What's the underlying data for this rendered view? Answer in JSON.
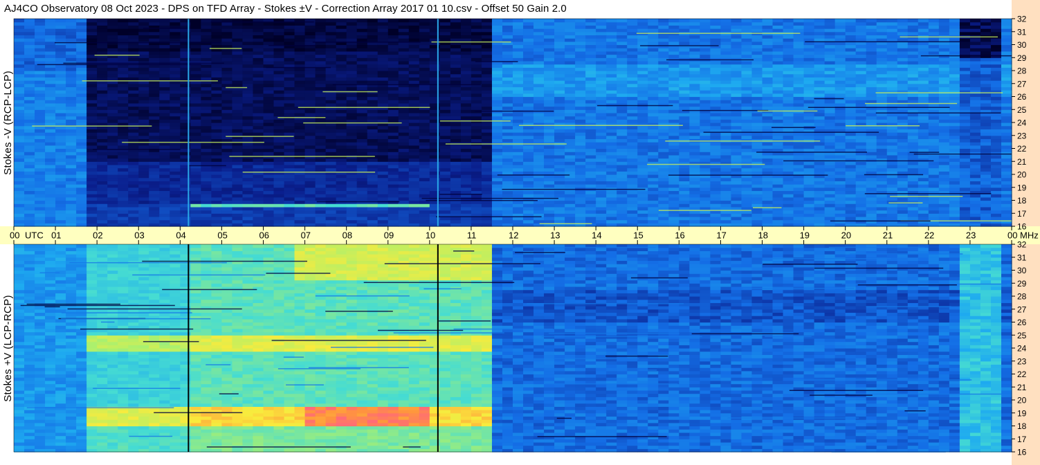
{
  "title": "AJ4CO Observatory  08 Oct 2023  -  DPS on TFD Array  -  Stokes ±V  -  Correction Array 2017 01 10.csv  -  Offset 50  Gain 2.0",
  "colors": {
    "axis_band": "#ffffc0",
    "right_band": "#ffe0c0",
    "tick": "#000000",
    "marker_top": "#2aa8e8",
    "marker_bottom": "#000000"
  },
  "chart_data": [
    {
      "type": "heatmap",
      "panel": "top",
      "ylabel": "Stokes -V (RCP-LCP)",
      "x_unit": "UTC",
      "y_unit": "MHz",
      "xlim": [
        0,
        24
      ],
      "ylim": [
        16,
        32
      ],
      "x_ticks": [
        "00",
        "01",
        "02",
        "03",
        "04",
        "05",
        "06",
        "07",
        "08",
        "09",
        "10",
        "11",
        "12",
        "13",
        "14",
        "15",
        "16",
        "17",
        "18",
        "19",
        "20",
        "21",
        "22",
        "23",
        "00"
      ],
      "y_ticks": [
        "16",
        "17",
        "18",
        "19",
        "20",
        "21",
        "22",
        "23",
        "24",
        "25",
        "26",
        "27",
        "28",
        "29",
        "30",
        "31",
        "32"
      ],
      "colormap": "jet",
      "vertical_markers_utc": [
        4.2,
        10.2
      ]
    },
    {
      "type": "heatmap",
      "panel": "bottom",
      "ylabel": "Stokes +V (LCP-RCP)",
      "x_unit": "UTC",
      "y_unit": "MHz",
      "xlim": [
        0,
        24
      ],
      "ylim": [
        16,
        32
      ],
      "x_ticks": [
        "00",
        "01",
        "02",
        "03",
        "04",
        "05",
        "06",
        "07",
        "08",
        "09",
        "10",
        "11",
        "12",
        "13",
        "14",
        "15",
        "16",
        "17",
        "18",
        "19",
        "20",
        "21",
        "22",
        "23",
        "00"
      ],
      "y_ticks": [
        "16",
        "17",
        "18",
        "19",
        "20",
        "21",
        "22",
        "23",
        "24",
        "25",
        "26",
        "27",
        "28",
        "29",
        "30",
        "31",
        "32"
      ],
      "colormap": "jet",
      "vertical_markers_utc": [
        4.2,
        10.2
      ]
    }
  ]
}
